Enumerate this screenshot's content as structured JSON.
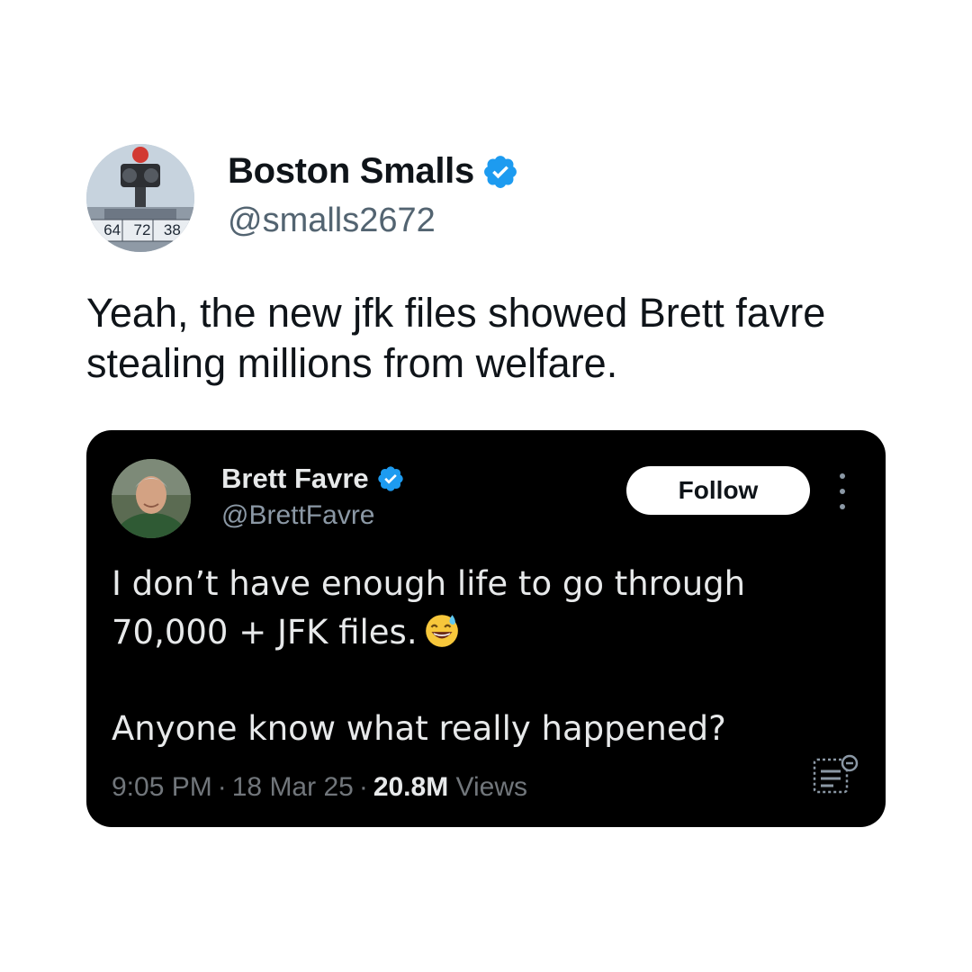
{
  "outer_tweet": {
    "display_name": "Boston Smalls",
    "handle": "@smalls2672",
    "avatar_icon": "robot-avatar",
    "avatar_label_numbers": [
      "64",
      "72",
      "38"
    ],
    "text": "Yeah, the new jfk files showed Brett favre stealing millions from welfare.",
    "verified": true
  },
  "quoted_tweet": {
    "display_name": "Brett Favre",
    "handle": "@BrettFavre",
    "verified": true,
    "follow_label": "Follow",
    "more_icon": "more-vertical-icon",
    "text_line_1": "I don’t have enough life to go through",
    "text_line_2": "70,000 + JFK files.",
    "emoji": "grinning-face-with-sweat",
    "text_line_3": "Anyone know what really happened?",
    "time": "9:05 PM",
    "date": "18 Mar 25",
    "separator": "·",
    "views_count": "20.8M",
    "views_label": "Views",
    "analytics_icon": "post-analytics-icon"
  },
  "colors": {
    "verified_blue": "#1d9bf0",
    "card_background": "#000000",
    "text_dark": "#0f1419",
    "text_muted_light": "#536471",
    "text_muted_dark": "#71767b"
  }
}
